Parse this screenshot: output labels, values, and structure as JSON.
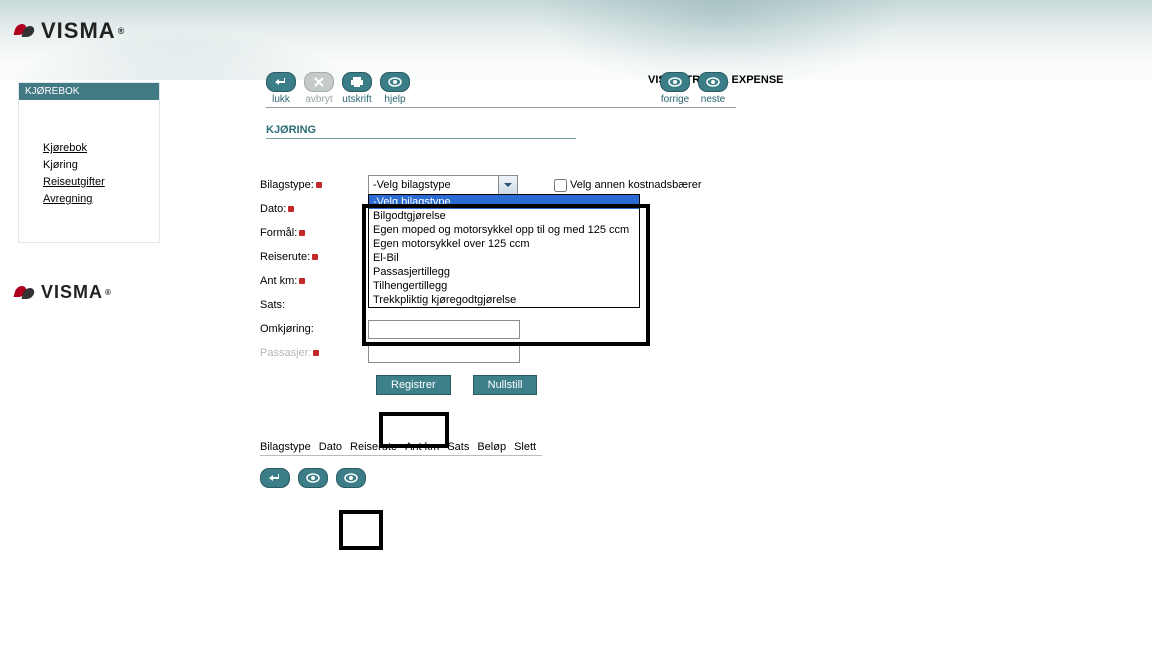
{
  "brand": {
    "name": "VISMA",
    "reg": "®"
  },
  "app_title": "VISMA TRAVEL EXPENSE",
  "sidebar": {
    "header": "KJØREBOK",
    "items": [
      {
        "label": "Kjørebok",
        "active": false
      },
      {
        "label": "Kjøring",
        "active": true
      },
      {
        "label": "Reiseutgifter",
        "active": false
      },
      {
        "label": "Avregning",
        "active": false
      }
    ]
  },
  "toolbar": {
    "items": [
      {
        "id": "close",
        "label": "lukk",
        "enabled": true,
        "icon": "return"
      },
      {
        "id": "cancel",
        "label": "avbryt",
        "enabled": false,
        "icon": "x"
      },
      {
        "id": "print",
        "label": "utskrift",
        "enabled": true,
        "icon": "print"
      },
      {
        "id": "help",
        "label": "hjelp",
        "enabled": true,
        "icon": "eye"
      }
    ],
    "nav": [
      {
        "id": "prev",
        "label": "forrige",
        "icon": "eye"
      },
      {
        "id": "next",
        "label": "neste",
        "icon": "eye"
      }
    ]
  },
  "section_title": "KJØRING",
  "form": {
    "labels": {
      "bilagstype": "Bilagstype:",
      "dato": "Dato:",
      "formal": "Formål:",
      "reiserute": "Reiserute:",
      "antkm": "Ant km:",
      "sats": "Sats:",
      "omkjoring": "Omkjøring:",
      "passasjer": "Passasjer:"
    },
    "bilagstype": {
      "selected": "-Velg bilagstype",
      "options": [
        "-Velg bilagstype",
        "Bilgodtgjørelse",
        "Egen moped og motorsykkel opp til og med 125 ccm",
        "Egen motorsykkel over 125 ccm",
        "El-Bil",
        "Passasjertillegg",
        "Tilhengertillegg",
        "Trekkpliktig kjøregodtgjørelse"
      ]
    },
    "other_cost_label": "Velg annen kostnadsbærer",
    "buttons": {
      "registrer": "Registrer",
      "nullstill": "Nullstill"
    }
  },
  "table": {
    "cols": [
      "Bilagstype",
      "Dato",
      "Reiserute",
      "Ant km",
      "Sats",
      "Beløp",
      "Slett"
    ]
  }
}
